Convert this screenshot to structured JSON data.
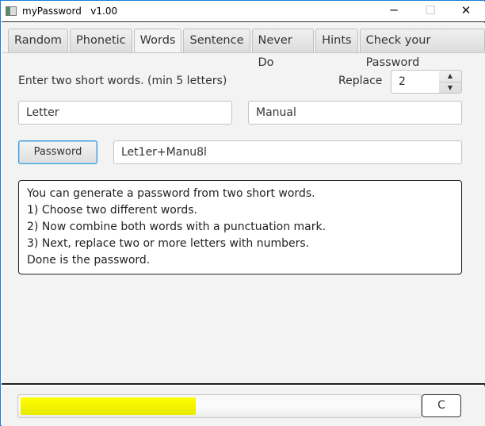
{
  "window": {
    "title": "myPassword   v1.00",
    "minimize": "─",
    "maximize": "☐",
    "close": "✕"
  },
  "tabs": [
    {
      "label": "Random"
    },
    {
      "label": "Phonetic"
    },
    {
      "label": "Words",
      "active": true
    },
    {
      "label": "Sentence"
    },
    {
      "label": "Never Do"
    },
    {
      "label": "Hints"
    },
    {
      "label": "Check your Password"
    }
  ],
  "words": {
    "instruction": "Enter two short words. (min 5 letters)",
    "replace_label": "Replace",
    "replace_value": "2",
    "word1": "Letter",
    "word2": "Manual",
    "password_button": "Password",
    "password_output": "Let1er+Manu8l",
    "info_lines": [
      "You can generate a password from two short words.",
      "1) Choose two different words.",
      "2) Now combine both words with a punctuation mark.",
      "3) Next, replace two or more letters with numbers.",
      "Done is the password."
    ]
  },
  "status": {
    "progress": 0.44,
    "progress_color": "#ffff00",
    "clear_button": "C"
  }
}
